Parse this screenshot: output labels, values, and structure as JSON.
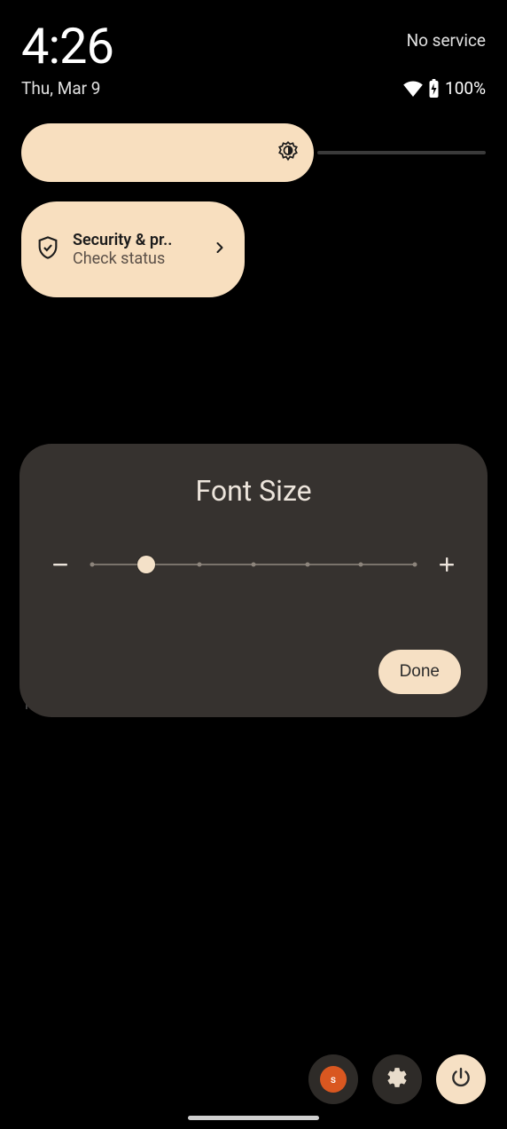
{
  "status": {
    "time": "4:26",
    "no_service": "No service",
    "date": "Thu, Mar 9",
    "battery_pct": "100%"
  },
  "brightness": {
    "value_pct": 63
  },
  "qs": {
    "security": {
      "title": "Security & pr..",
      "subtitle": "Check status"
    }
  },
  "dialog": {
    "title": "Font Size",
    "done_label": "Done",
    "slider": {
      "steps": 7,
      "index": 1
    }
  },
  "footer": {
    "avatar_letter": "s"
  },
  "bg_snippet": "id"
}
